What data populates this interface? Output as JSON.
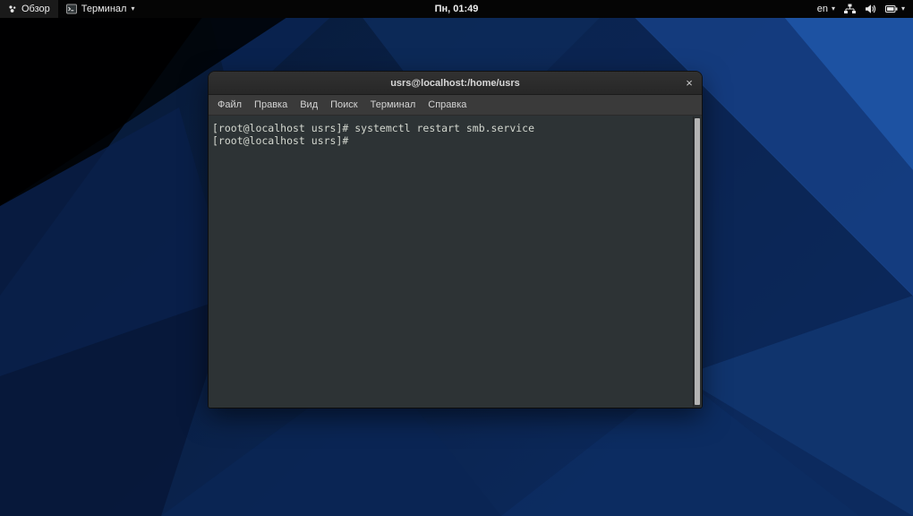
{
  "topbar": {
    "activities_label": "Обзор",
    "app_menu_label": "Терминал",
    "clock": "Пн, 01:49",
    "keyboard_layout": "en"
  },
  "icons": {
    "chevron_down": "▾",
    "close": "×"
  },
  "window": {
    "title": "usrs@localhost:/home/usrs",
    "menu": [
      "Файл",
      "Правка",
      "Вид",
      "Поиск",
      "Терминал",
      "Справка"
    ],
    "terminal": {
      "lines": [
        "[root@localhost usrs]# systemctl restart smb.service",
        "[root@localhost usrs]#"
      ]
    }
  },
  "colors": {
    "wallpaper_base": "#0a234f",
    "wallpaper_bright": "#1e55a6",
    "topbar_bg": "#050505",
    "terminal_bg": "#2d3335",
    "terminal_fg": "#d3d7cf"
  }
}
